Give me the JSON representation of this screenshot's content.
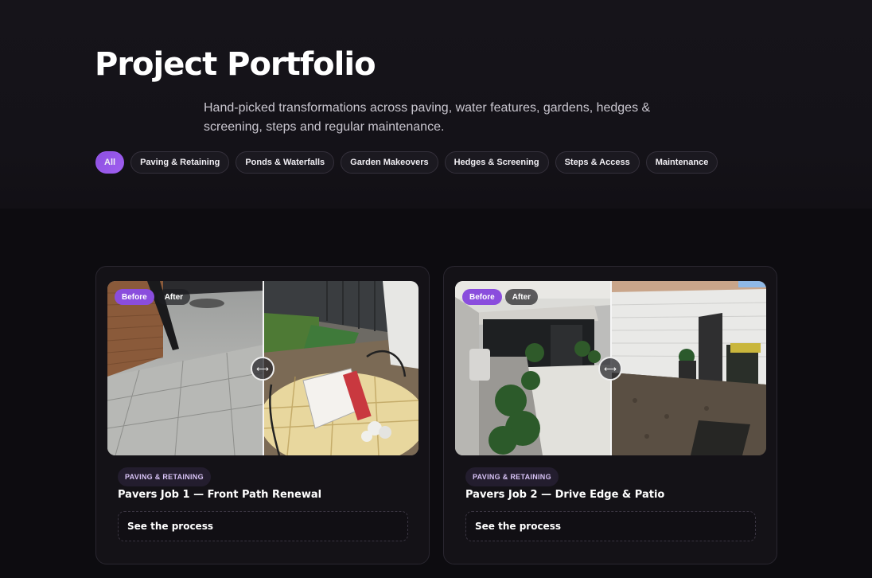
{
  "page": {
    "title": "Project Portfolio",
    "subtitle": "Hand-picked transformations across paving, water features, gardens, hedges & screening, steps and regular maintenance."
  },
  "filters": [
    {
      "label": "All",
      "active": true
    },
    {
      "label": "Paving & Retaining",
      "active": false
    },
    {
      "label": "Ponds & Waterfalls",
      "active": false
    },
    {
      "label": "Garden Makeovers",
      "active": false
    },
    {
      "label": "Hedges & Screening",
      "active": false
    },
    {
      "label": "Steps & Access",
      "active": false
    },
    {
      "label": "Maintenance",
      "active": false
    }
  ],
  "cards": [
    {
      "before_label": "Before",
      "after_label": "After",
      "category": "PAVING & RETAINING",
      "title": "Pavers Job 1 — Front Path Renewal",
      "process_label": "See the process",
      "slider_position": 0.5
    },
    {
      "before_label": "Before",
      "after_label": "After",
      "category": "PAVING & RETAINING",
      "title": "Pavers Job 2 — Drive Edge & Patio",
      "process_label": "See the process",
      "slider_position": 0.5
    }
  ],
  "colors": {
    "accent": "#8c4fe0",
    "background": "#0d0c10",
    "card": "#141217"
  }
}
